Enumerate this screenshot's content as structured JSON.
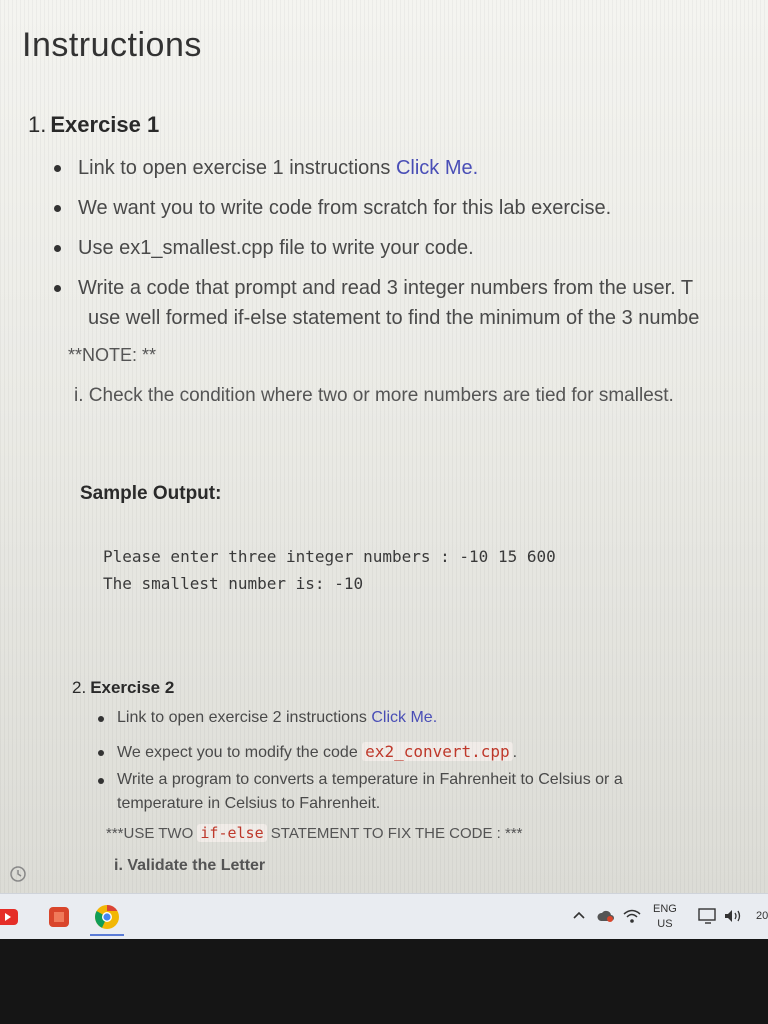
{
  "page": {
    "title": "Instructions"
  },
  "exercise1": {
    "number": "1.",
    "title": "Exercise 1",
    "bullets": [
      {
        "text": "Link to open exercise 1 instructions ",
        "link": "Click Me."
      },
      {
        "text": "We want you to write code from scratch for this lab exercise."
      },
      {
        "text": "Use ex1_smallest.cpp file to write your code."
      },
      {
        "text": "Write a code that prompt and read 3 integer numbers from the user. T",
        "text2": "use well formed if-else statement to find the minimum of the 3 numbe"
      }
    ],
    "note": "**NOTE: **",
    "subitem": "i. Check the condition where two or more numbers are tied for smallest."
  },
  "sample": {
    "label": "Sample Output:",
    "lines": [
      "Please enter three integer numbers : -10 15 600",
      "The smallest number is: -10"
    ]
  },
  "exercise2": {
    "number": "2.",
    "title": "Exercise 2",
    "bullets": [
      {
        "text": "Link to open exercise 2 instructions ",
        "link": "Click Me."
      },
      {
        "text": "We expect you to modify the code ",
        "code": "ex2_convert.cpp",
        "after": "."
      },
      {
        "text": "Write a program to converts a temperature in Fahrenheit to Celsius or a",
        "text2": "temperature in Celsius to Fahrenheit."
      }
    ],
    "note_before": "***USE TWO ",
    "note_code": "if-else",
    "note_after": " STATEMENT TO FIX THE CODE : ***",
    "subitem": "i. Validate the Letter"
  },
  "taskbar": {
    "apps": [
      {
        "icon": "youtube-icon",
        "color": "#e52d27"
      },
      {
        "icon": "office-icon",
        "color": "#d9452b"
      },
      {
        "icon": "chrome-icon",
        "color": "#f2b705"
      }
    ],
    "language": {
      "primary": "ENG",
      "secondary": "US"
    },
    "time_fragment": "20",
    "tray_icons": [
      "chevron-up-icon",
      "cloud-icon",
      "wifi-icon",
      "monitor-icon",
      "speaker-icon"
    ]
  }
}
